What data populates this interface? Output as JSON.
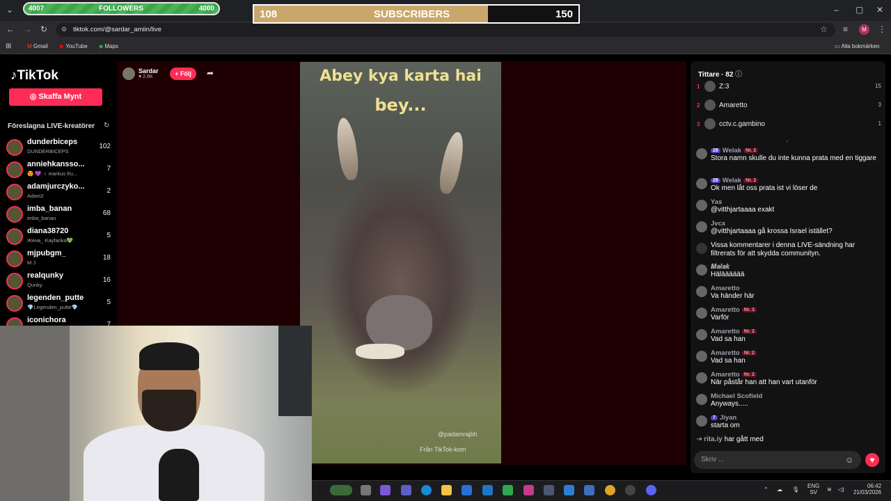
{
  "browser": {
    "url": "tiktok.com/@sardar_amiin/live",
    "bookmarks": [
      "Gmail",
      "YouTube",
      "Maps"
    ],
    "all_bookmarks": "Alla bokmärken",
    "profile_initial": "M"
  },
  "overlay": {
    "followers_label": "FOLLOWERS",
    "followers_current": "4007",
    "followers_goal": "4000",
    "subscribers_label": "SUBSCRIBERS",
    "subscribers_current": "108",
    "subscribers_goal": "150",
    "subscribers_progress": 0.72
  },
  "tiktok": {
    "logo": "TikTok",
    "coins_button": "Skaffa Mynt",
    "suggested_title": "Föreslagna LIVE-kreatörer",
    "creators": [
      {
        "name": "dunderbiceps",
        "sub": "DUNDERBICEPS",
        "count": "102"
      },
      {
        "name": "anniehkansso...",
        "sub": "😍 💜 ♁ markus fru...",
        "count": "7"
      },
      {
        "name": "adamjurczyko...",
        "sub": "Adam2",
        "count": "2"
      },
      {
        "name": "imba_banan",
        "sub": "imba_banan",
        "count": "68"
      },
      {
        "name": "diana38720",
        "sub": "Жена_ Kayfarika💚",
        "count": "5"
      },
      {
        "name": "mjpubgm_",
        "sub": "M J",
        "count": "18"
      },
      {
        "name": "realqunky",
        "sub": "Qunky",
        "count": "16"
      },
      {
        "name": "legenden_putte",
        "sub": "💎Legenden_putte💎",
        "count": "5"
      },
      {
        "name": "iconichora",
        "sub": "",
        "count": "7"
      }
    ]
  },
  "stream": {
    "streamer_name": "Sardar",
    "streamer_likes": "♥ 2.6K",
    "follow_button": "+ Följ",
    "caption_line1": "Abey kya karta hai",
    "caption_line2": "bey...",
    "watermark_user": "@padamrajbh",
    "watermark_brand": "Från TikTok-kom"
  },
  "viewers": {
    "title": "Tittare · 82",
    "top": [
      {
        "rank": "1",
        "name": "Z:3",
        "count": "15"
      },
      {
        "rank": "2",
        "name": "Amaretto",
        "count": "3"
      },
      {
        "rank": "3",
        "name": "cctv.c.gambino",
        "count": "1"
      }
    ]
  },
  "chat": {
    "messages": [
      {
        "user": "Welak",
        "level": "28",
        "rank": "Nr. 2",
        "text": "Stora namn skulle du inte kunna prata med en tiggare"
      },
      {
        "user": "Welak",
        "level": "28",
        "rank": "Nr. 2",
        "text": "Ok men låt oss prata ist vi löser de"
      },
      {
        "user": "Yas",
        "level": "",
        "rank": "",
        "text": "@vitthjartaaaa exakt"
      },
      {
        "user": "Jvcx",
        "level": "",
        "rank": "",
        "text": "@vitthjartaaaa gå krossa Israel istället?"
      },
      {
        "user": "",
        "level": "",
        "rank": "",
        "text": "Vissa kommentarer i denna LIVE-sändning har filtrerats för att skydda communityn."
      },
      {
        "user": "𝑴𝒂𝒍𝒂𝒌",
        "level": "",
        "rank": "",
        "text": "Hälääääää"
      },
      {
        "user": "Amaretto",
        "level": "",
        "rank": "",
        "text": "Va händer här"
      },
      {
        "user": "Amaretto",
        "level": "",
        "rank": "Nr. 3",
        "text": "Varför"
      },
      {
        "user": "Amaretto",
        "level": "",
        "rank": "Nr. 2",
        "text": "Vad sa han"
      },
      {
        "user": "Amaretto",
        "level": "",
        "rank": "Nr. 2",
        "text": "Vad sa han"
      },
      {
        "user": "Amaretto",
        "level": "",
        "rank": "Nr. 2",
        "text": "När påstår han att han vart utanför"
      },
      {
        "user": "Michael Scofield",
        "level": "",
        "rank": "",
        "text": "Anyways....."
      },
      {
        "user": "Jiyan",
        "level": "7",
        "rank": "",
        "text": "starta om"
      }
    ],
    "join_user": "rita.iy",
    "join_text": "har gått med",
    "input_placeholder": "Skriv ..."
  },
  "taskbar": {
    "lang": "ENG",
    "lang2": "SV",
    "time": "06:42",
    "date": "21/03/2026"
  },
  "colors": {
    "accent": "#fe2c55",
    "follower_bar": "#3fa34d",
    "sub_fill": "#c9a76b"
  }
}
